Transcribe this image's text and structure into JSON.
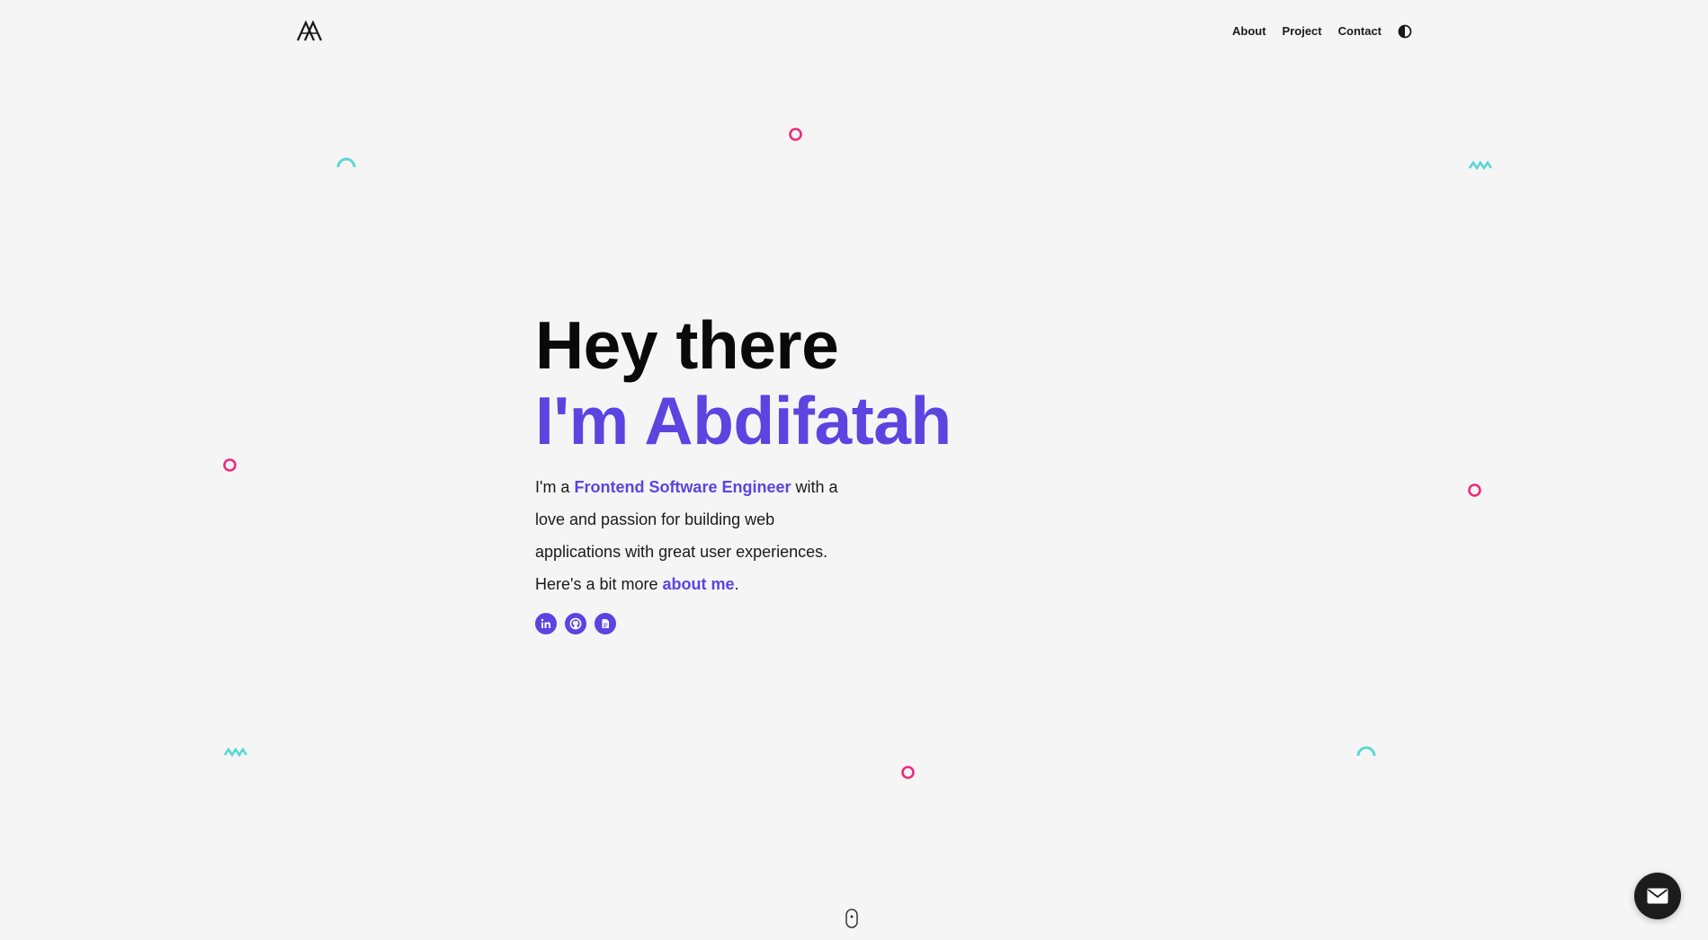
{
  "header": {
    "logo_icon": "monogram-logo",
    "nav": [
      {
        "label": "About"
      },
      {
        "label": "Project"
      },
      {
        "label": "Contact"
      }
    ],
    "theme_toggle_icon": "half-circle-contrast-icon"
  },
  "hero": {
    "heading_line1": "Hey there",
    "heading_line2": "I'm Abdifatah",
    "intro_prefix": "I'm a ",
    "intro_role": "Frontend Software Engineer",
    "intro_mid": " with a love and passion for building web applications with great user experiences.",
    "intro_more": "Here's a bit more ",
    "intro_link": "about me",
    "intro_end": ".",
    "socials": [
      {
        "icon": "linkedin-icon"
      },
      {
        "icon": "github-icon"
      },
      {
        "icon": "resume-document-icon"
      }
    ]
  },
  "scroll_indicator_icon": "mouse-scroll-icon",
  "fab_icon": "mail-icon",
  "colors": {
    "background": "#f5f5f6",
    "accent": "#5b44e0",
    "pink": "#ee2a7b",
    "teal": "#5cd6d6",
    "text": "#111111"
  }
}
